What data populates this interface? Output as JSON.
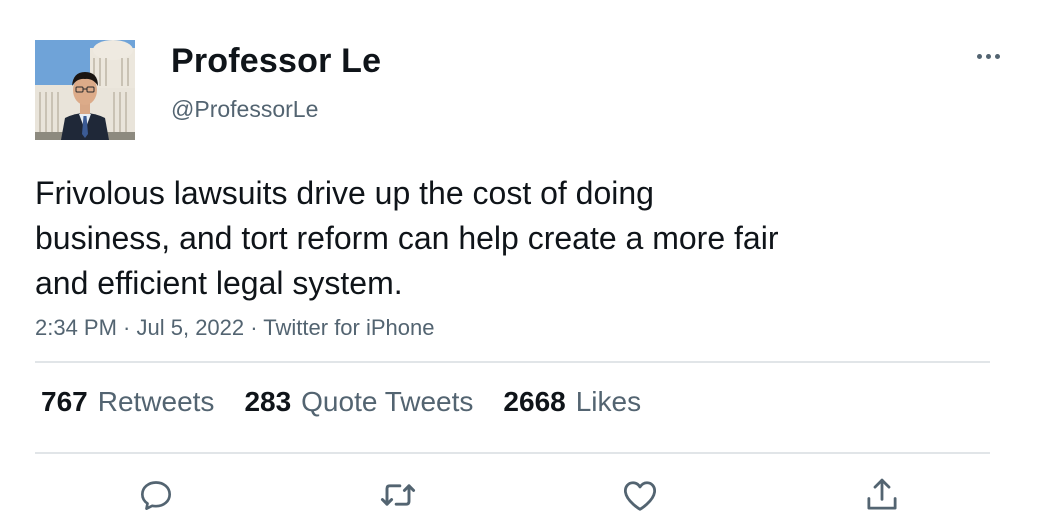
{
  "user": {
    "display_name": "Professor Le",
    "handle": "@ProfessorLe"
  },
  "tweet": {
    "text": "Frivolous lawsuits drive up the cost of doing\nbusiness, and tort reform can help create a more fair\nand efficient legal system.",
    "time": "2:34 PM",
    "date": "Jul 5, 2022",
    "source": "Twitter for iPhone",
    "separator": " · "
  },
  "stats": {
    "retweets": {
      "count": "767",
      "label": "Retweets"
    },
    "quotes": {
      "count": "283",
      "label": "Quote Tweets"
    },
    "likes": {
      "count": "2668",
      "label": "Likes"
    }
  },
  "icons": {
    "more": "more-horizontal-icon",
    "reply": "reply-icon",
    "retweet": "retweet-icon",
    "like": "heart-icon",
    "share": "share-icon"
  },
  "colors": {
    "text_primary": "#0f1419",
    "text_secondary": "#536471",
    "divider": "#e1e5e8"
  }
}
